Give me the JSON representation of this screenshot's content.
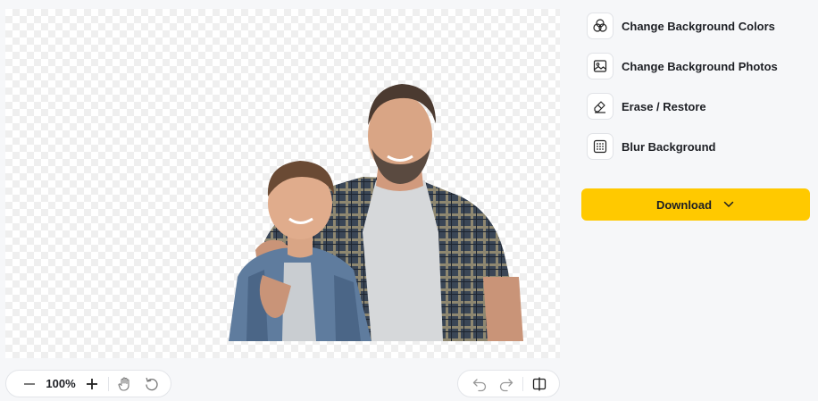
{
  "zoom": {
    "value": "100%"
  },
  "tools": [
    {
      "label": "Change Background Colors",
      "icon": "palette-circles-icon"
    },
    {
      "label": "Change Background Photos",
      "icon": "image-icon"
    },
    {
      "label": "Erase / Restore",
      "icon": "eraser-icon"
    },
    {
      "label": "Blur Background",
      "icon": "blur-grid-icon"
    }
  ],
  "download": {
    "label": "Download"
  },
  "colors": {
    "accent": "#ffc900",
    "background": "#f6f7f9"
  }
}
